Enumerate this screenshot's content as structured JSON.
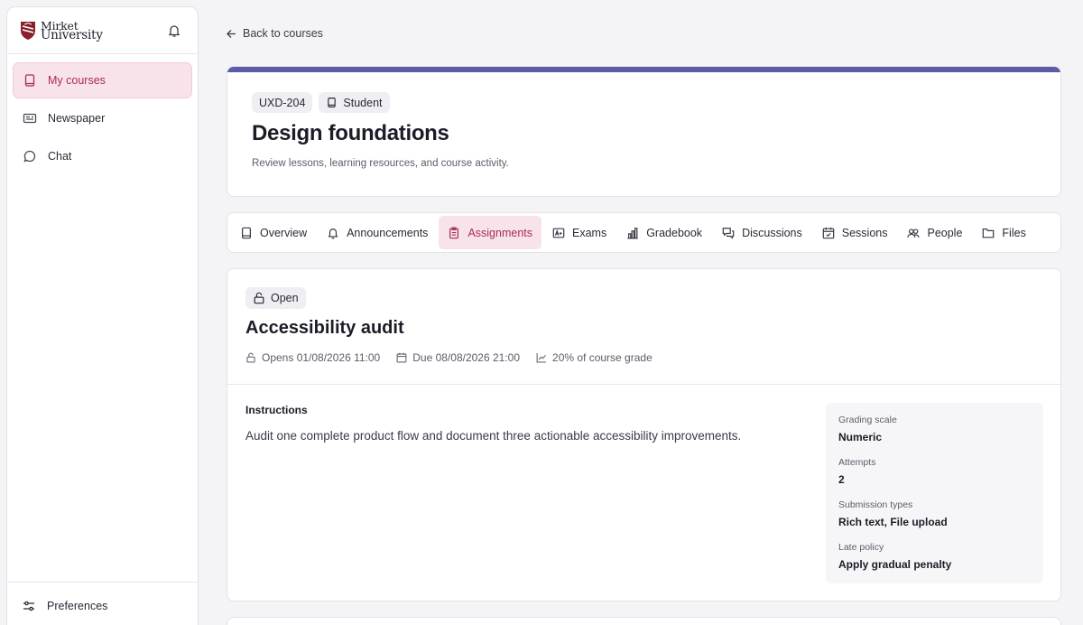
{
  "sidebar": {
    "logo": {
      "line1": "Mirket",
      "line2": "University",
      "brand_color": "#8a1e2b"
    },
    "nav_items": [
      {
        "label": "My courses",
        "icon": "book-icon",
        "active": true
      },
      {
        "label": "Newspaper",
        "icon": "newspaper-icon",
        "active": false
      },
      {
        "label": "Chat",
        "icon": "chat-bubble-icon",
        "active": false
      }
    ],
    "footer": {
      "label": "Preferences",
      "icon": "sliders-icon"
    }
  },
  "back_link": "Back to courses",
  "course": {
    "code": "UXD-204",
    "role": "Student",
    "title": "Design foundations",
    "subtitle": "Review lessons, learning resources, and course activity.",
    "accent_color": "#5b5ba6"
  },
  "tabs": [
    {
      "label": "Overview",
      "icon": "book-icon",
      "active": false
    },
    {
      "label": "Announcements",
      "icon": "bell-icon",
      "active": false
    },
    {
      "label": "Assignments",
      "icon": "clipboard-icon",
      "active": true
    },
    {
      "label": "Exams",
      "icon": "grade-icon",
      "active": false
    },
    {
      "label": "Gradebook",
      "icon": "bar-chart-icon",
      "active": false
    },
    {
      "label": "Discussions",
      "icon": "discussion-icon",
      "active": false
    },
    {
      "label": "Sessions",
      "icon": "calendar-check-icon",
      "active": false
    },
    {
      "label": "People",
      "icon": "people-icon",
      "active": false
    },
    {
      "label": "Files",
      "icon": "folder-icon",
      "active": false
    }
  ],
  "assignment": {
    "status": "Open",
    "title": "Accessibility audit",
    "opens": "Opens 01/08/2026 11:00",
    "due": "Due 08/08/2026 21:00",
    "weight": "20% of course grade",
    "instructions_label": "Instructions",
    "instructions": "Audit one complete product flow and document three actionable accessibility improvements.",
    "details": [
      {
        "label": "Grading scale",
        "value": "Numeric"
      },
      {
        "label": "Attempts",
        "value": "2"
      },
      {
        "label": "Submission types",
        "value": "Rich text, File upload"
      },
      {
        "label": "Late policy",
        "value": "Apply gradual penalty"
      }
    ]
  },
  "colors": {
    "active_bg": "#f9e3ea",
    "active_text": "#a72d56"
  }
}
